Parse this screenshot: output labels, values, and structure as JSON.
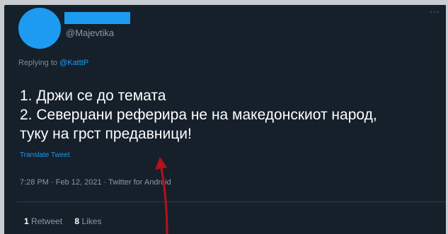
{
  "tweet": {
    "handle": "@Majevtika",
    "reply_prefix": "Replying to ",
    "reply_target": "@KatttP",
    "text_lines": [
      "1. Држи се до темата",
      "2. Северџани реферира не на македонскиот народ,",
      "туку на грст предавници!"
    ],
    "translate_label": "Translate Tweet",
    "timestamp": "7:28 PM · Feb 12, 2021 · Twitter for Android",
    "stats": {
      "retweets_count": "1",
      "retweets_label": "Retweet",
      "likes_count": "8",
      "likes_label": "Likes"
    }
  },
  "more_icon": "···",
  "colors": {
    "background": "#15202b",
    "accent": "#1d9bf0",
    "annotation_arrow": "#b5121b"
  }
}
